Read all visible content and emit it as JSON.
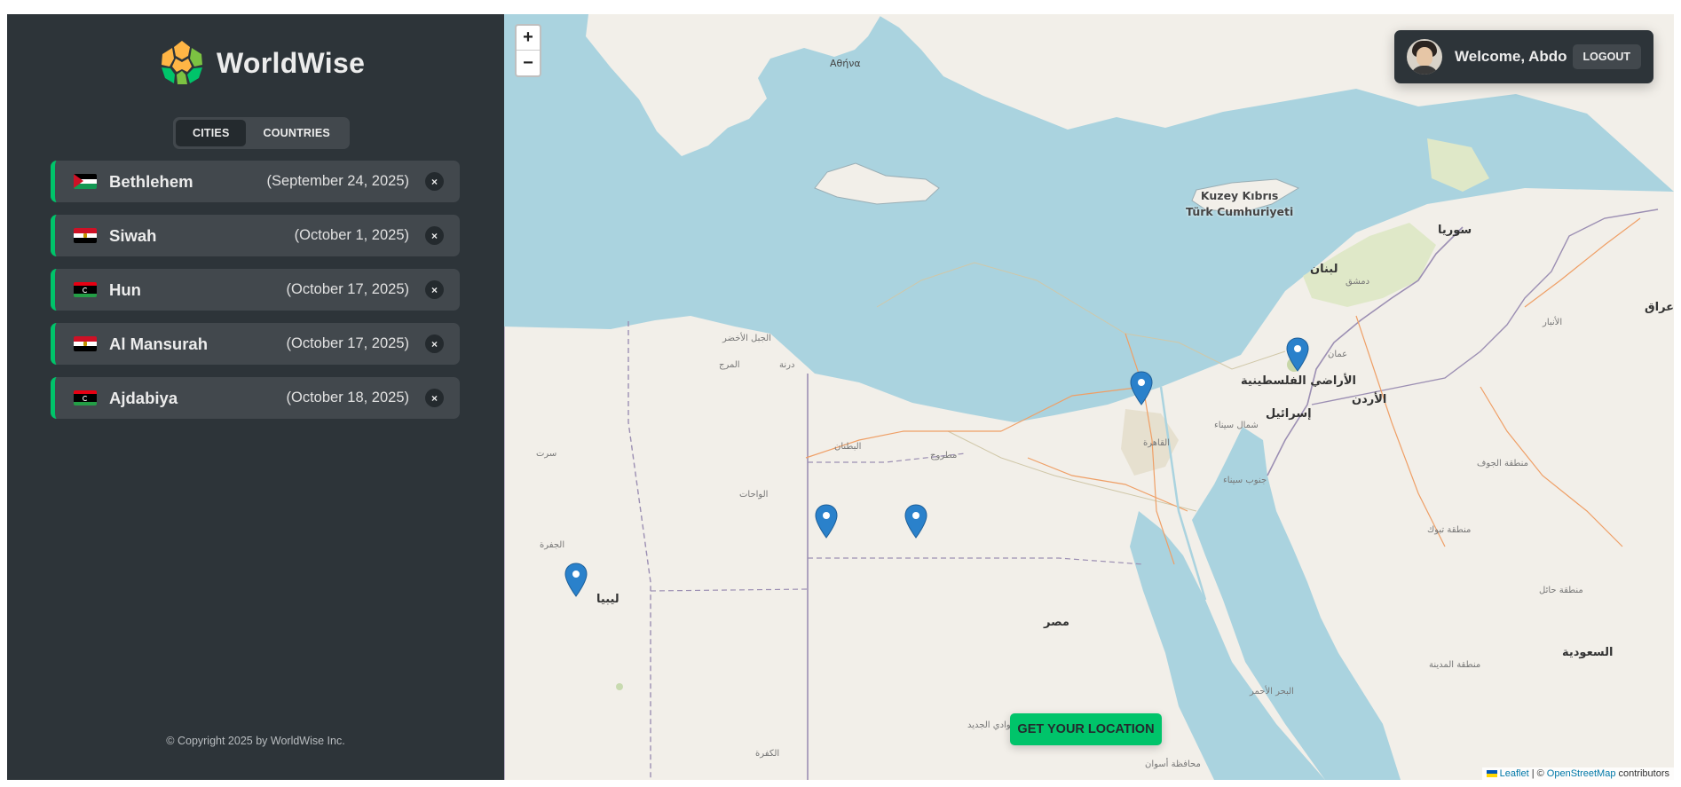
{
  "app": {
    "name": "WorldWise"
  },
  "tabs": [
    {
      "label": "Cities",
      "active": true
    },
    {
      "label": "Countries",
      "active": false
    }
  ],
  "cities": [
    {
      "name": "Bethlehem",
      "date": "(September 24, 2025)",
      "flag": "palestine",
      "delete": "×"
    },
    {
      "name": "Siwah",
      "date": "(October 1, 2025)",
      "flag": "egypt",
      "delete": "×"
    },
    {
      "name": "Hun",
      "date": "(October 17, 2025)",
      "flag": "libya",
      "delete": "×"
    },
    {
      "name": "Al Mansurah",
      "date": "(October 17, 2025)",
      "flag": "egypt",
      "delete": "×"
    },
    {
      "name": "Ajdabiya",
      "date": "(October 18, 2025)",
      "flag": "libya",
      "delete": "×"
    }
  ],
  "footer": {
    "copyright": "© Copyright 2025 by WorldWise Inc."
  },
  "map": {
    "zoom_in": "+",
    "zoom_out": "−",
    "locate_button": "Get your location",
    "attribution": {
      "leaflet": "Leaflet",
      "separator": "| ©",
      "osm": "OpenStreetMap",
      "suffix": "contributors"
    },
    "labels": {
      "athens": "Αθήνα",
      "cyprus_line1": "Kuzey Kıbrıs",
      "cyprus_line2": "Türk Cumhuriyeti",
      "syria": "سوريا",
      "lebanon": "لبنان",
      "damascus": "دمشق",
      "palestine": "الأراضي الفلسطينية",
      "israel": "إسرائيل",
      "jordan": "الأردن",
      "amman": "عمان",
      "cairo": "القاهرة",
      "egypt": "مصر",
      "libya": "ليبيا",
      "saudi": "السعودية",
      "iraq": "عراق",
      "matrouh": "مطروح",
      "red_sea": "البحر الأحمر",
      "jufra": "الجفرة",
      "kufra": "الكفرة",
      "wahat": "الواحات",
      "butnan": "البطنان",
      "marj": "المرج",
      "derna": "درنة",
      "jabal": "الجبل الأخضر",
      "sirte": "سرت",
      "north_sinai": "شمال سيناء",
      "south_sinai": "جنوب سيناء",
      "tabuk": "منطقة تبوك",
      "jawf": "منطقة الجوف",
      "hail": "منطقة حائل",
      "madinah": "منطقة المدينة",
      "anbar": "الأنبار",
      "aswan": "محافظة أسوان",
      "new_valley": "الوادي الجديد"
    }
  },
  "user": {
    "welcome": "Welcome, Abdo",
    "logout": "Logout"
  },
  "colors": {
    "accent": "#00c46a",
    "sidebar": "#2d3439",
    "item": "#42484d",
    "sea": "#aad3df",
    "land": "#f2efe9",
    "marker": "#2a81cb"
  }
}
